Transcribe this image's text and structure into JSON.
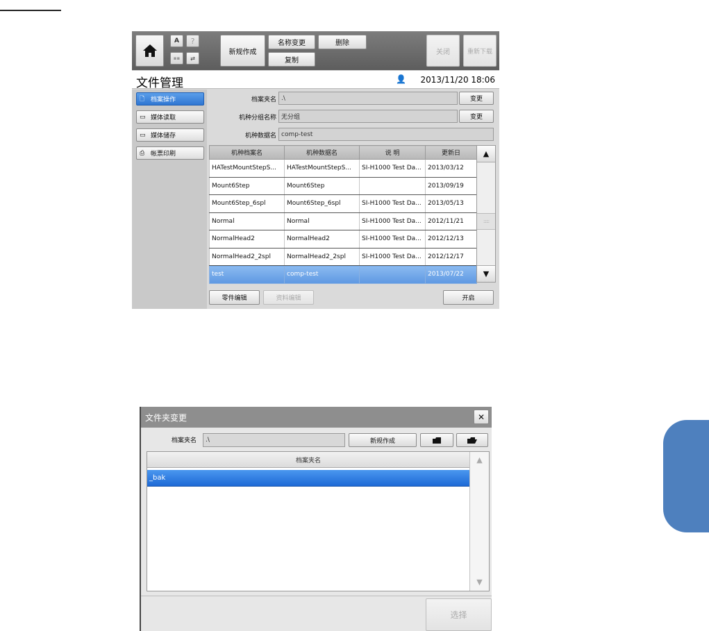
{
  "screen1": {
    "toolbar": {
      "home_icon": "house-icon",
      "mini_icons": [
        "A",
        "?",
        "",
        ""
      ],
      "new_label": "新规作成",
      "rename_label": "名称变更",
      "delete_label": "删除",
      "copy_label": "复制",
      "close_label": "关闭",
      "reload_label": "重新下载"
    },
    "title": "文件管理",
    "datetime": "2013/11/20 18:06",
    "sidebar": {
      "items": [
        {
          "label": "档案操作",
          "icon": "file-search-icon",
          "active": true
        },
        {
          "label": "媒体读取",
          "icon": "media-read-icon",
          "active": false
        },
        {
          "label": "媒体储存",
          "icon": "media-save-icon",
          "active": false
        },
        {
          "label": "帐票印刷",
          "icon": "printer-icon",
          "active": false
        }
      ]
    },
    "fields": {
      "folder_label": "档案夹名",
      "folder_value": ".\\",
      "group_label": "机种分组名称",
      "group_value": "无分组",
      "data_label": "机种数据名",
      "data_value": "comp-test",
      "change_label": "变更"
    },
    "table": {
      "headers": [
        "机种档案名",
        "机种数据名",
        "说 明",
        "更新日"
      ],
      "rows": [
        [
          "HATestMountStepS...",
          "HATestMountStepS...",
          "SI-H1000 Test Da...",
          "2013/03/12"
        ],
        [
          "Mount6Step",
          "Mount6Step",
          "",
          "2013/09/19"
        ],
        [
          "Mount6Step_6spl",
          "Mount6Step_6spl",
          "SI-H1000 Test Da...",
          "2013/05/13"
        ],
        [
          "Normal",
          "Normal",
          "SI-H1000 Test Da...",
          "2012/11/21"
        ],
        [
          "NormalHead2",
          "NormalHead2",
          "SI-H1000 Test Da...",
          "2012/12/13"
        ],
        [
          "NormalHead2_2spl",
          "NormalHead2_2spl",
          "SI-H1000 Test Da...",
          "2012/12/17"
        ],
        [
          "test",
          "comp-test",
          "",
          "2013/07/22"
        ]
      ],
      "selected_row": 6
    },
    "bottom": {
      "parts_edit_label": "零件编辑",
      "data_edit_label": "资料编辑",
      "open_label": "开启"
    }
  },
  "screen2": {
    "title": "文件夹变更",
    "close_symbol": "✕",
    "folder_label": "档案夹名",
    "folder_value": ".\\",
    "new_label": "新规作成",
    "list_header": "档案夹名",
    "list_items": [
      "_bak"
    ],
    "select_label": "选择"
  },
  "colors": {
    "accent_blue": "#2f76d2",
    "side_tab": "#4e80be",
    "toolbar_gray": "#6b6b6b"
  }
}
